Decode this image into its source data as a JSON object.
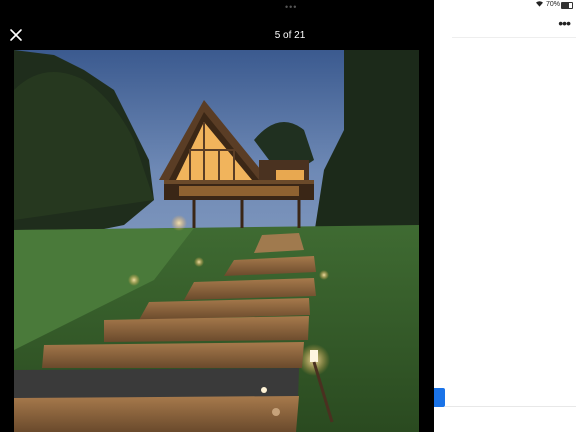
{
  "status_bar": {
    "battery_text": "70%",
    "wifi_icon": "wifi-icon",
    "battery_icon": "battery-icon"
  },
  "viewer": {
    "counter": "5 of 21",
    "close_icon": "close-icon",
    "more_icon": "more-horizontal-icon",
    "handle": "•••"
  },
  "photo": {
    "subject": "a-frame-cabin-at-night"
  },
  "colors": {
    "viewer_bg": "#000000",
    "page_bg": "#ffffff",
    "accent": "#1a73e8"
  }
}
